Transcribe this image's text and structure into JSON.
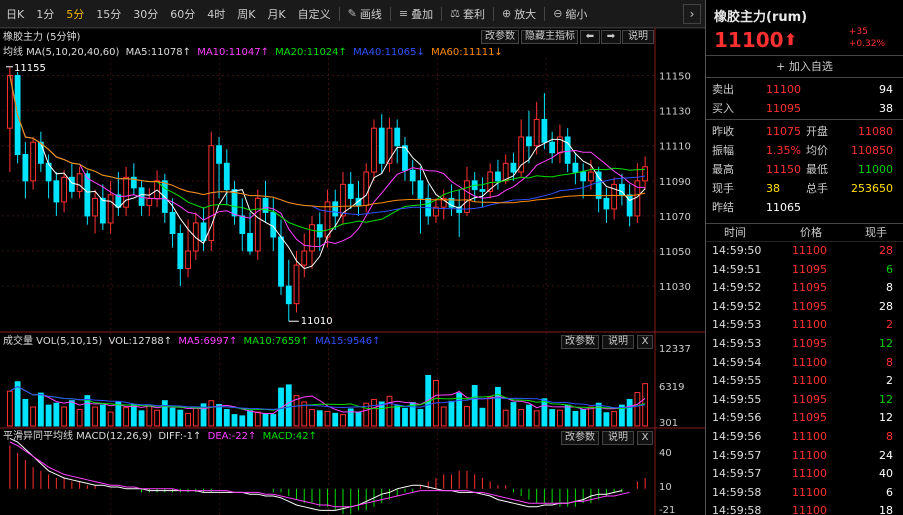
{
  "toolbar": {
    "items": [
      "日K",
      "1分",
      "5分",
      "15分",
      "30分",
      "60分",
      "4时",
      "周K",
      "月K",
      "自定义"
    ],
    "active_index": 2,
    "tools": [
      {
        "icon": "draw-line-icon",
        "label": "画线"
      },
      {
        "icon": "overlay-icon",
        "label": "叠加"
      },
      {
        "icon": "arbitrage-icon",
        "label": "套利"
      },
      {
        "icon": "zoom-in-icon",
        "label": "放大"
      },
      {
        "icon": "zoom-out-icon",
        "label": "缩小"
      }
    ],
    "expand": "›"
  },
  "main_panel": {
    "title": "橡胶主力 (5分钟)",
    "legend": {
      "prefix": "均线 MA(5,10,20,40,60)",
      "ma5": "MA5:11078↑",
      "ma10": "MA10:11047↑",
      "ma20": "MA20:11024↑",
      "ma40": "MA40:11065↓",
      "ma60": "MA60:11111↓"
    },
    "buttons": [
      "改参数",
      "隐藏主指标",
      "⬅",
      "➡",
      "说明"
    ],
    "high_label": "11155",
    "low_label": "11010",
    "yticks": [
      "11150",
      "11130",
      "11110",
      "11090",
      "11070",
      "11050",
      "11030"
    ]
  },
  "vol_panel": {
    "legend": {
      "prefix": "成交量 VOL(5,10,15)",
      "vol": "VOL:12788↑",
      "ma5": "MA5:6997↑",
      "ma10": "MA10:7659↑",
      "ma15": "MA15:9546↑"
    },
    "buttons": [
      "改参数",
      "说明",
      "X"
    ],
    "yticks": [
      "12337",
      "6319",
      "301"
    ]
  },
  "macd_panel": {
    "legend": {
      "prefix": "平滑异同平均线 MACD(12,26,9)",
      "diff": "DIFF:-1↑",
      "dea": "DEA:-22↑",
      "macd": "MACD:42↑"
    },
    "buttons": [
      "改参数",
      "说明",
      "X"
    ],
    "yticks": [
      "40",
      "10",
      "-21"
    ]
  },
  "colors": {
    "up": "#ff3030",
    "down": "#00e5ff",
    "ma5": "#ffffff",
    "ma10": "#ff40ff",
    "ma20": "#00e000",
    "ma40": "#3050ff",
    "ma60": "#ff8c00",
    "accent": "#f0b400"
  },
  "chart_data": {
    "type": "candlestick",
    "price_range": [
      11005,
      11160
    ],
    "candles": [
      [
        11120,
        11150,
        11155,
        11095
      ],
      [
        11150,
        11105,
        11152,
        11100
      ],
      [
        11105,
        11090,
        11112,
        11080
      ],
      [
        11090,
        11112,
        11115,
        11085
      ],
      [
        11112,
        11100,
        11118,
        11095
      ],
      [
        11100,
        11090,
        11105,
        11080
      ],
      [
        11090,
        11078,
        11095,
        11070
      ],
      [
        11078,
        11092,
        11096,
        11072
      ],
      [
        11092,
        11084,
        11100,
        11080
      ],
      [
        11084,
        11094,
        11098,
        11080
      ],
      [
        11094,
        11070,
        11096,
        11065
      ],
      [
        11070,
        11080,
        11085,
        11060
      ],
      [
        11080,
        11066,
        11088,
        11062
      ],
      [
        11066,
        11082,
        11090,
        11060
      ],
      [
        11082,
        11075,
        11095,
        11070
      ],
      [
        11075,
        11092,
        11098,
        11070
      ],
      [
        11092,
        11086,
        11100,
        11082
      ],
      [
        11086,
        11076,
        11090,
        11070
      ],
      [
        11076,
        11080,
        11086,
        11070
      ],
      [
        11080,
        11090,
        11096,
        11075
      ],
      [
        11090,
        11072,
        11094,
        11066
      ],
      [
        11072,
        11060,
        11080,
        11052
      ],
      [
        11060,
        11040,
        11065,
        11030
      ],
      [
        11040,
        11050,
        11068,
        11035
      ],
      [
        11050,
        11066,
        11072,
        11045
      ],
      [
        11066,
        11056,
        11075,
        11050
      ],
      [
        11056,
        11110,
        11118,
        11050
      ],
      [
        11110,
        11100,
        11115,
        11080
      ],
      [
        11100,
        11085,
        11108,
        11076
      ],
      [
        11085,
        11070,
        11090,
        11065
      ],
      [
        11070,
        11060,
        11080,
        11050
      ],
      [
        11060,
        11050,
        11072,
        11048
      ],
      [
        11050,
        11080,
        11085,
        11045
      ],
      [
        11080,
        11072,
        11090,
        11066
      ],
      [
        11072,
        11058,
        11080,
        11050
      ],
      [
        11058,
        11030,
        11068,
        11025
      ],
      [
        11030,
        11020,
        11045,
        11010
      ],
      [
        11020,
        11042,
        11050,
        11015
      ],
      [
        11042,
        11050,
        11060,
        11035
      ],
      [
        11050,
        11065,
        11070,
        11040
      ],
      [
        11065,
        11058,
        11072,
        11050
      ],
      [
        11058,
        11078,
        11085,
        11052
      ],
      [
        11078,
        11070,
        11085,
        11062
      ],
      [
        11070,
        11088,
        11095,
        11065
      ],
      [
        11088,
        11080,
        11095,
        11074
      ],
      [
        11080,
        11076,
        11090,
        11070
      ],
      [
        11076,
        11095,
        11100,
        11072
      ],
      [
        11095,
        11120,
        11125,
        11090
      ],
      [
        11120,
        11100,
        11128,
        11094
      ],
      [
        11100,
        11120,
        11126,
        11095
      ],
      [
        11120,
        11110,
        11125,
        11100
      ],
      [
        11110,
        11096,
        11115,
        11090
      ],
      [
        11096,
        11090,
        11102,
        11082
      ],
      [
        11090,
        11080,
        11098,
        11060
      ],
      [
        11080,
        11070,
        11088,
        11065
      ],
      [
        11070,
        11075,
        11080,
        11066
      ],
      [
        11075,
        11080,
        11085,
        11068
      ],
      [
        11080,
        11075,
        11088,
        11070
      ],
      [
        11075,
        11072,
        11085,
        11058
      ],
      [
        11072,
        11090,
        11098,
        11070
      ],
      [
        11090,
        11085,
        11095,
        11078
      ],
      [
        11085,
        11084,
        11092,
        11075
      ],
      [
        11084,
        11095,
        11100,
        11080
      ],
      [
        11095,
        11090,
        11102,
        11085
      ],
      [
        11090,
        11100,
        11105,
        11088
      ],
      [
        11100,
        11095,
        11106,
        11090
      ],
      [
        11095,
        11115,
        11125,
        11092
      ],
      [
        11115,
        11110,
        11130,
        11100
      ],
      [
        11110,
        11125,
        11135,
        11105
      ],
      [
        11125,
        11112,
        11140,
        11108
      ],
      [
        11112,
        11106,
        11118,
        11100
      ],
      [
        11106,
        11115,
        11122,
        11100
      ],
      [
        11115,
        11100,
        11120,
        11095
      ],
      [
        11100,
        11095,
        11106,
        11088
      ],
      [
        11095,
        11090,
        11100,
        11080
      ],
      [
        11090,
        11095,
        11102,
        11085
      ],
      [
        11095,
        11080,
        11098,
        11072
      ],
      [
        11080,
        11074,
        11086,
        11066
      ],
      [
        11074,
        11088,
        11092,
        11068
      ],
      [
        11088,
        11082,
        11094,
        11076
      ],
      [
        11082,
        11070,
        11088,
        11064
      ],
      [
        11070,
        11090,
        11100,
        11066
      ],
      [
        11090,
        11098,
        11104,
        11085
      ]
    ],
    "volumes": [
      5500,
      7000,
      4200,
      3000,
      5200,
      3300,
      3600,
      3000,
      4000,
      2600,
      4800,
      3000,
      3300,
      2200,
      3800,
      2900,
      3400,
      2400,
      3200,
      2500,
      4000,
      2800,
      2500,
      2000,
      2800,
      3500,
      4000,
      3400,
      2600,
      1800,
      1600,
      2400,
      2200,
      1900,
      1800,
      6000,
      6500,
      4800,
      3800,
      2600,
      2400,
      2300,
      2000,
      1800,
      2700,
      2200,
      3600,
      4200,
      3800,
      4700,
      3200,
      2800,
      3700,
      2600,
      8000,
      7200,
      3000,
      3900,
      5200,
      3100,
      6400,
      2800,
      4600,
      6100,
      2500,
      3700,
      2600,
      3300,
      2400,
      4300,
      2600,
      2500,
      3300,
      2300,
      2600,
      3000,
      3600,
      2100,
      2300,
      3300,
      4200,
      5300,
      6700
    ],
    "macd": [
      12,
      10,
      8,
      6,
      5,
      4,
      3,
      3,
      2,
      2,
      1,
      1,
      0,
      0,
      0,
      0,
      0,
      -1,
      -1,
      -1,
      -1,
      -1,
      -1,
      -1,
      -1,
      -1,
      -1,
      0,
      0,
      0,
      0,
      0,
      0,
      0,
      -1,
      -1,
      -2,
      -3,
      -4,
      -4,
      -5,
      -5,
      -6,
      -7,
      -7,
      -6,
      -6,
      -5,
      -4,
      -3,
      -2,
      -1,
      -1,
      1,
      2,
      3,
      4,
      4,
      5,
      5,
      4,
      3,
      2,
      1,
      1,
      -1,
      -2,
      -3,
      -4,
      -4,
      -4,
      -5,
      -5,
      -5,
      -4,
      -4,
      -3,
      -2,
      -1,
      -1,
      0,
      2,
      3
    ],
    "diff_line": [
      28,
      26,
      22,
      18,
      14,
      10,
      8,
      6,
      5,
      4,
      3,
      2,
      2,
      1,
      1,
      0,
      0,
      0,
      -1,
      -1,
      -1,
      -1,
      -1,
      -1,
      -1,
      -2,
      -2,
      -2,
      -2,
      -2,
      -2,
      -3,
      -3,
      -4,
      -4,
      -5,
      -7,
      -9,
      -10,
      -11,
      -12,
      -12,
      -12,
      -11,
      -10,
      -9,
      -7,
      -5,
      -3,
      -2,
      0,
      1,
      2,
      2,
      1,
      0,
      -1,
      -1,
      -2,
      -2,
      -2,
      -3,
      -4,
      -6,
      -7,
      -8,
      -9,
      -10,
      -10,
      -9,
      -9,
      -8,
      -8,
      -7,
      -6,
      -4,
      -3,
      -3,
      -2,
      -1
    ],
    "dea_line": [
      26,
      24,
      21,
      18,
      15,
      12,
      10,
      8,
      7,
      6,
      5,
      4,
      3,
      2,
      2,
      1,
      1,
      0,
      0,
      0,
      0,
      0,
      -1,
      -1,
      -1,
      -1,
      -1,
      -1,
      -1,
      -2,
      -2,
      -2,
      -2,
      -3,
      -3,
      -4,
      -5,
      -6,
      -7,
      -8,
      -9,
      -9,
      -10,
      -10,
      -10,
      -9,
      -8,
      -7,
      -6,
      -5,
      -4,
      -3,
      -2,
      -1,
      -1,
      -1,
      -1,
      -1,
      -1,
      -1,
      -2,
      -2,
      -3,
      -4,
      -5,
      -6,
      -7,
      -8,
      -8,
      -8,
      -8,
      -8,
      -8,
      -7,
      -7,
      -6,
      -5,
      -4,
      -4,
      -3,
      -2
    ]
  },
  "quote": {
    "name": "橡胶主力(rum)",
    "price": "11100",
    "arrow": "⬆",
    "change": "+35",
    "change_pct": "+0.32%",
    "add_favorite": "+ 加入自选",
    "sell_label": "卖出",
    "sell_price": "11100",
    "sell_vol": "94",
    "buy_label": "买入",
    "buy_price": "11095",
    "buy_vol": "38",
    "stats": [
      {
        "l1": "昨收",
        "v1": "11075",
        "l2": "开盘",
        "v2": "11080"
      },
      {
        "l1": "振幅",
        "v1": "1.35%",
        "l2": "均价",
        "v2": "110850"
      },
      {
        "l1": "最高",
        "v1": "11150",
        "l2": "最低",
        "v2": "11000"
      },
      {
        "l1": "现手",
        "v1": "38",
        "l2": "总手",
        "v2": "253650"
      },
      {
        "l1": "昨结",
        "v1": "11065",
        "l2": "",
        "v2": ""
      }
    ],
    "ticks_header": {
      "time": "时间",
      "price": "价格",
      "vol": "现手"
    },
    "ticks": [
      {
        "time": "14:59:50",
        "price": "11100",
        "vol": "28",
        "vc": "red"
      },
      {
        "time": "14:59:51",
        "price": "11095",
        "vol": "6",
        "vc": "green"
      },
      {
        "time": "14:59:52",
        "price": "11095",
        "vol": "8",
        "vc": "white"
      },
      {
        "time": "14:59:52",
        "price": "11095",
        "vol": "28",
        "vc": "white"
      },
      {
        "time": "14:59:53",
        "price": "11100",
        "vol": "2",
        "vc": "red"
      },
      {
        "time": "14:59:53",
        "price": "11095",
        "vol": "12",
        "vc": "green"
      },
      {
        "time": "14:59:54",
        "price": "11100",
        "vol": "8",
        "vc": "red"
      },
      {
        "time": "14:59:55",
        "price": "11100",
        "vol": "2",
        "vc": "white"
      },
      {
        "time": "14:59:55",
        "price": "11095",
        "vol": "12",
        "vc": "green"
      },
      {
        "time": "14:59:56",
        "price": "11095",
        "vol": "12",
        "vc": "white"
      },
      {
        "time": "14:59:56",
        "price": "11100",
        "vol": "8",
        "vc": "red"
      },
      {
        "time": "14:59:57",
        "price": "11100",
        "vol": "24",
        "vc": "white"
      },
      {
        "time": "14:59:57",
        "price": "11100",
        "vol": "40",
        "vc": "white"
      },
      {
        "time": "14:59:58",
        "price": "11100",
        "vol": "6",
        "vc": "white"
      },
      {
        "time": "14:59:58",
        "price": "11100",
        "vol": "18",
        "vc": "white"
      }
    ]
  }
}
